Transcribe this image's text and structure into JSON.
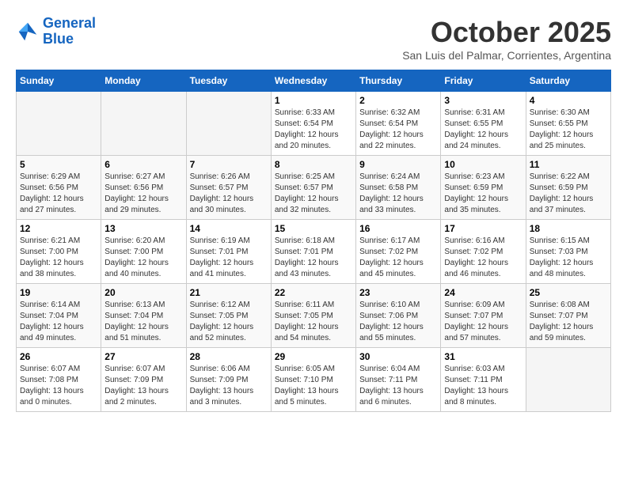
{
  "header": {
    "logo_line1": "General",
    "logo_line2": "Blue",
    "month": "October 2025",
    "location": "San Luis del Palmar, Corrientes, Argentina"
  },
  "weekdays": [
    "Sunday",
    "Monday",
    "Tuesday",
    "Wednesday",
    "Thursday",
    "Friday",
    "Saturday"
  ],
  "weeks": [
    [
      {
        "day": "",
        "info": ""
      },
      {
        "day": "",
        "info": ""
      },
      {
        "day": "",
        "info": ""
      },
      {
        "day": "1",
        "info": "Sunrise: 6:33 AM\nSunset: 6:54 PM\nDaylight: 12 hours\nand 20 minutes."
      },
      {
        "day": "2",
        "info": "Sunrise: 6:32 AM\nSunset: 6:54 PM\nDaylight: 12 hours\nand 22 minutes."
      },
      {
        "day": "3",
        "info": "Sunrise: 6:31 AM\nSunset: 6:55 PM\nDaylight: 12 hours\nand 24 minutes."
      },
      {
        "day": "4",
        "info": "Sunrise: 6:30 AM\nSunset: 6:55 PM\nDaylight: 12 hours\nand 25 minutes."
      }
    ],
    [
      {
        "day": "5",
        "info": "Sunrise: 6:29 AM\nSunset: 6:56 PM\nDaylight: 12 hours\nand 27 minutes."
      },
      {
        "day": "6",
        "info": "Sunrise: 6:27 AM\nSunset: 6:56 PM\nDaylight: 12 hours\nand 29 minutes."
      },
      {
        "day": "7",
        "info": "Sunrise: 6:26 AM\nSunset: 6:57 PM\nDaylight: 12 hours\nand 30 minutes."
      },
      {
        "day": "8",
        "info": "Sunrise: 6:25 AM\nSunset: 6:57 PM\nDaylight: 12 hours\nand 32 minutes."
      },
      {
        "day": "9",
        "info": "Sunrise: 6:24 AM\nSunset: 6:58 PM\nDaylight: 12 hours\nand 33 minutes."
      },
      {
        "day": "10",
        "info": "Sunrise: 6:23 AM\nSunset: 6:59 PM\nDaylight: 12 hours\nand 35 minutes."
      },
      {
        "day": "11",
        "info": "Sunrise: 6:22 AM\nSunset: 6:59 PM\nDaylight: 12 hours\nand 37 minutes."
      }
    ],
    [
      {
        "day": "12",
        "info": "Sunrise: 6:21 AM\nSunset: 7:00 PM\nDaylight: 12 hours\nand 38 minutes."
      },
      {
        "day": "13",
        "info": "Sunrise: 6:20 AM\nSunset: 7:00 PM\nDaylight: 12 hours\nand 40 minutes."
      },
      {
        "day": "14",
        "info": "Sunrise: 6:19 AM\nSunset: 7:01 PM\nDaylight: 12 hours\nand 41 minutes."
      },
      {
        "day": "15",
        "info": "Sunrise: 6:18 AM\nSunset: 7:01 PM\nDaylight: 12 hours\nand 43 minutes."
      },
      {
        "day": "16",
        "info": "Sunrise: 6:17 AM\nSunset: 7:02 PM\nDaylight: 12 hours\nand 45 minutes."
      },
      {
        "day": "17",
        "info": "Sunrise: 6:16 AM\nSunset: 7:02 PM\nDaylight: 12 hours\nand 46 minutes."
      },
      {
        "day": "18",
        "info": "Sunrise: 6:15 AM\nSunset: 7:03 PM\nDaylight: 12 hours\nand 48 minutes."
      }
    ],
    [
      {
        "day": "19",
        "info": "Sunrise: 6:14 AM\nSunset: 7:04 PM\nDaylight: 12 hours\nand 49 minutes."
      },
      {
        "day": "20",
        "info": "Sunrise: 6:13 AM\nSunset: 7:04 PM\nDaylight: 12 hours\nand 51 minutes."
      },
      {
        "day": "21",
        "info": "Sunrise: 6:12 AM\nSunset: 7:05 PM\nDaylight: 12 hours\nand 52 minutes."
      },
      {
        "day": "22",
        "info": "Sunrise: 6:11 AM\nSunset: 7:05 PM\nDaylight: 12 hours\nand 54 minutes."
      },
      {
        "day": "23",
        "info": "Sunrise: 6:10 AM\nSunset: 7:06 PM\nDaylight: 12 hours\nand 55 minutes."
      },
      {
        "day": "24",
        "info": "Sunrise: 6:09 AM\nSunset: 7:07 PM\nDaylight: 12 hours\nand 57 minutes."
      },
      {
        "day": "25",
        "info": "Sunrise: 6:08 AM\nSunset: 7:07 PM\nDaylight: 12 hours\nand 59 minutes."
      }
    ],
    [
      {
        "day": "26",
        "info": "Sunrise: 6:07 AM\nSunset: 7:08 PM\nDaylight: 13 hours\nand 0 minutes."
      },
      {
        "day": "27",
        "info": "Sunrise: 6:07 AM\nSunset: 7:09 PM\nDaylight: 13 hours\nand 2 minutes."
      },
      {
        "day": "28",
        "info": "Sunrise: 6:06 AM\nSunset: 7:09 PM\nDaylight: 13 hours\nand 3 minutes."
      },
      {
        "day": "29",
        "info": "Sunrise: 6:05 AM\nSunset: 7:10 PM\nDaylight: 13 hours\nand 5 minutes."
      },
      {
        "day": "30",
        "info": "Sunrise: 6:04 AM\nSunset: 7:11 PM\nDaylight: 13 hours\nand 6 minutes."
      },
      {
        "day": "31",
        "info": "Sunrise: 6:03 AM\nSunset: 7:11 PM\nDaylight: 13 hours\nand 8 minutes."
      },
      {
        "day": "",
        "info": ""
      }
    ]
  ]
}
